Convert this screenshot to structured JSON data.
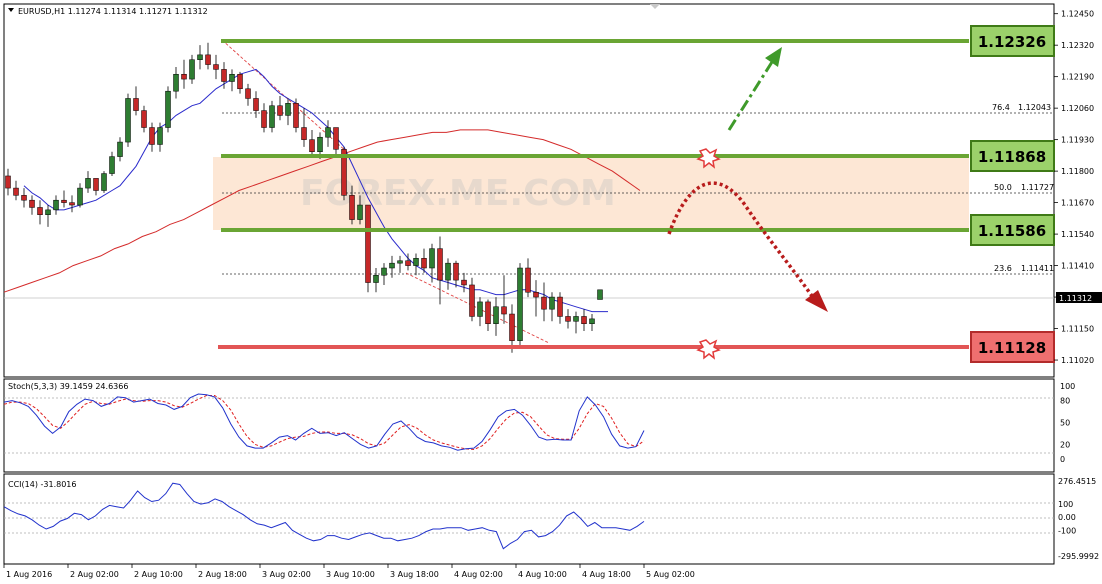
{
  "colors": {
    "support_resistance": "#6aa534",
    "support_red": "#e25555",
    "ma_blue": "#2b2bcc",
    "ma_red": "#d42b2b",
    "bull_candle": "#2e7d32",
    "bear_candle": "#c62828",
    "zone_fill": "#fde7d5",
    "label_green_bg": "#9bd16a",
    "label_red_bg": "#ef6f6f"
  },
  "main": {
    "header": "EURUSD,H1  1.11274 1.11314 1.11271 1.11312",
    "price_axis_ticks": [
      "1.12450",
      "1.12320",
      "1.12190",
      "1.12060",
      "1.11930",
      "1.11800",
      "1.11670",
      "1.11540",
      "1.11410",
      "1.11280",
      "1.11150",
      "1.11020"
    ],
    "current_price": "1.11312",
    "fib_labels": [
      {
        "ratio": "76.4",
        "price": "1.12043"
      },
      {
        "ratio": "50.0",
        "price": "1.11727"
      },
      {
        "ratio": "23.6",
        "price": "1.11411"
      }
    ],
    "levels": [
      {
        "value": "1.12326",
        "kind": "resistance"
      },
      {
        "value": "1.11868",
        "kind": "resistance"
      },
      {
        "value": "1.11586",
        "kind": "support"
      },
      {
        "value": "1.11128",
        "kind": "support-red"
      }
    ],
    "watermark": "FOREX.ME.COM",
    "time_labels": [
      "1 Aug 2016",
      "2 Aug 02:00",
      "2 Aug 10:00",
      "2 Aug 18:00",
      "3 Aug 02:00",
      "3 Aug 10:00",
      "3 Aug 18:00",
      "4 Aug 02:00",
      "4 Aug 10:00",
      "4 Aug 18:00",
      "5 Aug 02:00"
    ]
  },
  "stoch": {
    "header": "Stoch(5,3,3) 39.1459 24.6366",
    "ticks": [
      "100",
      "80",
      "50",
      "20",
      "0"
    ]
  },
  "cci": {
    "header": "CCI(14) -31.8016",
    "ticks": [
      "276.4515",
      "100",
      "0.00",
      "-100",
      "-295.9992"
    ]
  },
  "chart_data": [
    {
      "type": "candlestick",
      "title": "EURUSD,H1",
      "ylim": [
        1.1095,
        1.1249
      ],
      "ohlc": [
        [
          1.1178,
          1.1181,
          1.117,
          1.1173
        ],
        [
          1.1173,
          1.1176,
          1.1168,
          1.117
        ],
        [
          1.117,
          1.1173,
          1.1165,
          1.1168
        ],
        [
          1.1168,
          1.117,
          1.1162,
          1.1165
        ],
        [
          1.1165,
          1.1168,
          1.1158,
          1.1162
        ],
        [
          1.1162,
          1.1166,
          1.1157,
          1.1164
        ],
        [
          1.1164,
          1.117,
          1.1162,
          1.1168
        ],
        [
          1.1168,
          1.1172,
          1.1165,
          1.1167
        ],
        [
          1.1167,
          1.117,
          1.1163,
          1.1166
        ],
        [
          1.1166,
          1.1175,
          1.1165,
          1.1173
        ],
        [
          1.1173,
          1.118,
          1.1171,
          1.1177
        ],
        [
          1.1177,
          1.1176,
          1.117,
          1.1172
        ],
        [
          1.1172,
          1.118,
          1.1171,
          1.1179
        ],
        [
          1.1179,
          1.1188,
          1.1178,
          1.1186
        ],
        [
          1.1186,
          1.1194,
          1.1184,
          1.1192
        ],
        [
          1.1192,
          1.1212,
          1.119,
          1.121
        ],
        [
          1.121,
          1.1215,
          1.1203,
          1.1205
        ],
        [
          1.1205,
          1.1207,
          1.1196,
          1.1198
        ],
        [
          1.1198,
          1.12,
          1.1188,
          1.1191
        ],
        [
          1.1191,
          1.12,
          1.1188,
          1.1198
        ],
        [
          1.1198,
          1.1215,
          1.1196,
          1.1213
        ],
        [
          1.1213,
          1.1223,
          1.121,
          1.122
        ],
        [
          1.122,
          1.1226,
          1.1214,
          1.1218
        ],
        [
          1.1218,
          1.1228,
          1.1216,
          1.1226
        ],
        [
          1.1226,
          1.1232,
          1.1222,
          1.1228
        ],
        [
          1.1228,
          1.1233,
          1.1222,
          1.1224
        ],
        [
          1.1224,
          1.1228,
          1.1218,
          1.1222
        ],
        [
          1.1222,
          1.1225,
          1.1214,
          1.1217
        ],
        [
          1.1217,
          1.1222,
          1.1213,
          1.122
        ],
        [
          1.122,
          1.1221,
          1.1212,
          1.1214
        ],
        [
          1.1214,
          1.1216,
          1.1207,
          1.121
        ],
        [
          1.121,
          1.1213,
          1.1202,
          1.1205
        ],
        [
          1.1205,
          1.1208,
          1.1196,
          1.1198
        ],
        [
          1.1198,
          1.1209,
          1.1196,
          1.1207
        ],
        [
          1.1207,
          1.1211,
          1.1201,
          1.1203
        ],
        [
          1.1203,
          1.121,
          1.1199,
          1.1208
        ],
        [
          1.1208,
          1.121,
          1.1196,
          1.1198
        ],
        [
          1.1198,
          1.1206,
          1.119,
          1.1193
        ],
        [
          1.1193,
          1.1197,
          1.1186,
          1.1188
        ],
        [
          1.1188,
          1.1196,
          1.1185,
          1.1194
        ],
        [
          1.1194,
          1.1201,
          1.119,
          1.1198
        ],
        [
          1.1198,
          1.1197,
          1.1186,
          1.1189
        ],
        [
          1.1189,
          1.119,
          1.1168,
          1.117
        ],
        [
          1.117,
          1.1174,
          1.1158,
          1.116
        ],
        [
          1.116,
          1.117,
          1.1158,
          1.1166
        ],
        [
          1.1166,
          1.1164,
          1.113,
          1.1134
        ],
        [
          1.1134,
          1.114,
          1.113,
          1.1137
        ],
        [
          1.1137,
          1.1142,
          1.1133,
          1.114
        ],
        [
          1.114,
          1.1145,
          1.1136,
          1.1142
        ],
        [
          1.1142,
          1.1145,
          1.1138,
          1.1143
        ],
        [
          1.1143,
          1.1146,
          1.1139,
          1.1141
        ],
        [
          1.1141,
          1.1146,
          1.1137,
          1.1144
        ],
        [
          1.1144,
          1.1148,
          1.1138,
          1.114
        ],
        [
          1.114,
          1.115,
          1.1134,
          1.1148
        ],
        [
          1.1148,
          1.1153,
          1.1125,
          1.1135
        ],
        [
          1.1135,
          1.1144,
          1.1131,
          1.1142
        ],
        [
          1.1142,
          1.1143,
          1.1132,
          1.1135
        ],
        [
          1.1135,
          1.1138,
          1.113,
          1.1133
        ],
        [
          1.1133,
          1.1136,
          1.1118,
          1.112
        ],
        [
          1.112,
          1.1128,
          1.1116,
          1.1126
        ],
        [
          1.1126,
          1.1127,
          1.1114,
          1.1117
        ],
        [
          1.1117,
          1.1128,
          1.1112,
          1.1124
        ],
        [
          1.1124,
          1.1137,
          1.1117,
          1.1121
        ],
        [
          1.1121,
          1.1125,
          1.1105,
          1.111
        ],
        [
          1.111,
          1.1142,
          1.1108,
          1.114
        ],
        [
          1.114,
          1.1144,
          1.1128,
          1.113
        ],
        [
          1.113,
          1.1135,
          1.112,
          1.1128
        ],
        [
          1.1128,
          1.1134,
          1.1118,
          1.1123
        ],
        [
          1.1123,
          1.113,
          1.1118,
          1.1128
        ],
        [
          1.1128,
          1.113,
          1.1117,
          1.112
        ],
        [
          1.112,
          1.1123,
          1.1115,
          1.1118
        ],
        [
          1.1118,
          1.1122,
          1.1113,
          1.112
        ],
        [
          1.112,
          1.1123,
          1.1114,
          1.1117
        ],
        [
          1.1117,
          1.1121,
          1.1114,
          1.1119
        ],
        [
          1.1127,
          1.1131,
          1.1127,
          1.1131
        ]
      ],
      "ma_fast": [
        1.1174,
        1.1171,
        1.1169,
        1.1166,
        1.1164,
        1.1164,
        1.1165,
        1.1166,
        1.1167,
        1.1168,
        1.117,
        1.1172,
        1.1174,
        1.1178,
        1.1182,
        1.1188,
        1.1194,
        1.1198,
        1.12,
        1.1203,
        1.1205,
        1.1207,
        1.1208,
        1.1211,
        1.1214,
        1.1216,
        1.1218,
        1.122,
        1.1221,
        1.1222,
        1.1219,
        1.1215,
        1.1212,
        1.121,
        1.1208,
        1.1206,
        1.1204,
        1.1201,
        1.1198,
        1.1194,
        1.119,
        1.1183,
        1.1176,
        1.1169,
        1.1163,
        1.1157,
        1.1152,
        1.1148,
        1.1144,
        1.1141,
        1.1139,
        1.1136,
        1.1135,
        1.1134,
        1.1133,
        1.1132,
        1.1131,
        1.1131,
        1.113,
        1.1129,
        1.1129,
        1.113,
        1.1131,
        1.1131,
        1.113,
        1.1129,
        1.1127,
        1.1126,
        1.1125,
        1.1124,
        1.1123,
        1.1122,
        1.1122,
        1.1122
      ],
      "ma_slow": [
        1.113,
        1.1132,
        1.1134,
        1.1136,
        1.1138,
        1.1141,
        1.1143,
        1.1145,
        1.1148,
        1.115,
        1.1153,
        1.1155,
        1.1158,
        1.116,
        1.1163,
        1.1166,
        1.1169,
        1.1172,
        1.1174,
        1.1176,
        1.1178,
        1.118,
        1.1182,
        1.1184,
        1.1186,
        1.1188,
        1.119,
        1.1192,
        1.1193,
        1.1194,
        1.1195,
        1.1196,
        1.1196,
        1.1197,
        1.1197,
        1.1197,
        1.1196,
        1.1195,
        1.1194,
        1.1193,
        1.1191,
        1.1189,
        1.1186,
        1.1183,
        1.118,
        1.1176,
        1.1172
      ]
    },
    {
      "type": "line",
      "title": "Stoch(5,3,3)",
      "ylim": [
        0,
        100
      ],
      "series": [
        {
          "name": "main",
          "values": [
            78,
            80,
            77,
            72,
            60,
            45,
            35,
            44,
            65,
            75,
            82,
            80,
            72,
            76,
            85,
            84,
            78,
            80,
            82,
            76,
            74,
            68,
            72,
            84,
            89,
            88,
            85,
            70,
            48,
            30,
            18,
            15,
            15,
            22,
            30,
            32,
            26,
            35,
            42,
            35,
            36,
            32,
            36,
            28,
            20,
            15,
            18,
            34,
            48,
            52,
            42,
            30,
            24,
            22,
            18,
            16,
            12,
            14,
            15,
            24,
            40,
            58,
            66,
            68,
            60,
            46,
            30,
            26,
            27,
            26,
            26,
            66,
            85,
            74,
            58,
            34,
            18,
            15,
            17,
            39
          ]
        },
        {
          "name": "signal",
          "values": [
            75,
            78,
            78,
            76,
            69,
            58,
            46,
            42,
            52,
            64,
            75,
            79,
            76,
            75,
            79,
            82,
            80,
            79,
            80,
            80,
            78,
            73,
            71,
            76,
            82,
            87,
            87,
            80,
            67,
            48,
            31,
            20,
            16,
            18,
            23,
            28,
            30,
            31,
            35,
            37,
            37,
            35,
            35,
            33,
            28,
            21,
            18,
            22,
            33,
            44,
            47,
            42,
            33,
            26,
            22,
            19,
            16,
            14,
            13,
            18,
            28,
            42,
            55,
            63,
            64,
            58,
            45,
            33,
            28,
            27,
            27,
            42,
            62,
            76,
            72,
            56,
            36,
            21,
            17,
            25
          ]
        }
      ]
    },
    {
      "type": "line",
      "title": "CCI(14)",
      "ylim": [
        -295.9992,
        276.4515
      ],
      "series": [
        {
          "name": "CCI",
          "values": [
            80,
            50,
            25,
            10,
            -20,
            -60,
            -90,
            -70,
            -30,
            -10,
            30,
            20,
            -20,
            10,
            60,
            90,
            80,
            70,
            130,
            200,
            150,
            120,
            130,
            180,
            260,
            250,
            180,
            120,
            100,
            110,
            140,
            120,
            80,
            50,
            20,
            -20,
            -50,
            -60,
            -80,
            -60,
            -40,
            -100,
            -130,
            -160,
            -180,
            -170,
            -140,
            -140,
            -160,
            -170,
            -150,
            -130,
            -120,
            -140,
            -160,
            -160,
            -180,
            -170,
            -160,
            -140,
            -110,
            -90,
            -90,
            -80,
            -80,
            -80,
            -100,
            -90,
            -80,
            -100,
            -110,
            -240,
            -200,
            -170,
            -110,
            -100,
            -150,
            -140,
            -110,
            -60,
            10,
            40,
            -10,
            -70,
            -40,
            -80,
            -80,
            -80,
            -90,
            -100,
            -70,
            -32
          ]
        }
      ]
    }
  ]
}
